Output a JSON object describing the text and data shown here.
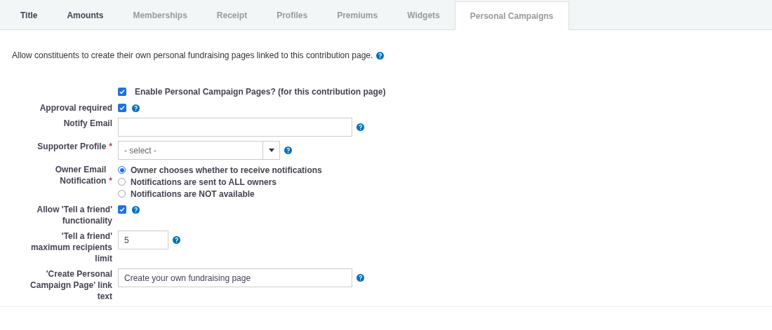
{
  "tabs": [
    {
      "label": "Title",
      "selected": false,
      "disabled": false
    },
    {
      "label": "Amounts",
      "selected": false,
      "disabled": false
    },
    {
      "label": "Memberships",
      "selected": false,
      "disabled": true
    },
    {
      "label": "Receipt",
      "selected": false,
      "disabled": true
    },
    {
      "label": "Profiles",
      "selected": false,
      "disabled": true
    },
    {
      "label": "Premiums",
      "selected": false,
      "disabled": true
    },
    {
      "label": "Widgets",
      "selected": false,
      "disabled": true
    },
    {
      "label": "Personal Campaigns",
      "selected": true,
      "disabled": true
    }
  ],
  "intro": "Allow constituents to create their own personal fundraising pages linked to this contribution page.",
  "enable": {
    "label": "Enable Personal Campaign Pages? (for this contribution page)",
    "checked": true
  },
  "fields": [
    {
      "kind": "checkbox",
      "label": "Approval required",
      "checked": true
    },
    {
      "kind": "text",
      "label": "Notify Email"
    },
    {
      "kind": "select",
      "label": "Supporter Profile",
      "marker": "*",
      "value": "- select -"
    },
    {
      "kind": "radio",
      "label": "Owner Email Notification",
      "marker": "*",
      "options": [
        {
          "label": "Owner chooses whether to receive notifications",
          "selected": true
        },
        {
          "label": "Notifications are sent to ALL owners",
          "selected": false
        },
        {
          "label": "Notifications are NOT available",
          "selected": false
        }
      ]
    },
    {
      "kind": "checkbox",
      "label": "Allow 'Tell a friend' functionality",
      "checked": true
    },
    {
      "kind": "number",
      "label": "'Tell a friend' maximum recipients limit",
      "value": "5"
    },
    {
      "kind": "text",
      "label": "'Create Personal Campaign Page' link text",
      "value": "Create your own fundraising page"
    }
  ]
}
